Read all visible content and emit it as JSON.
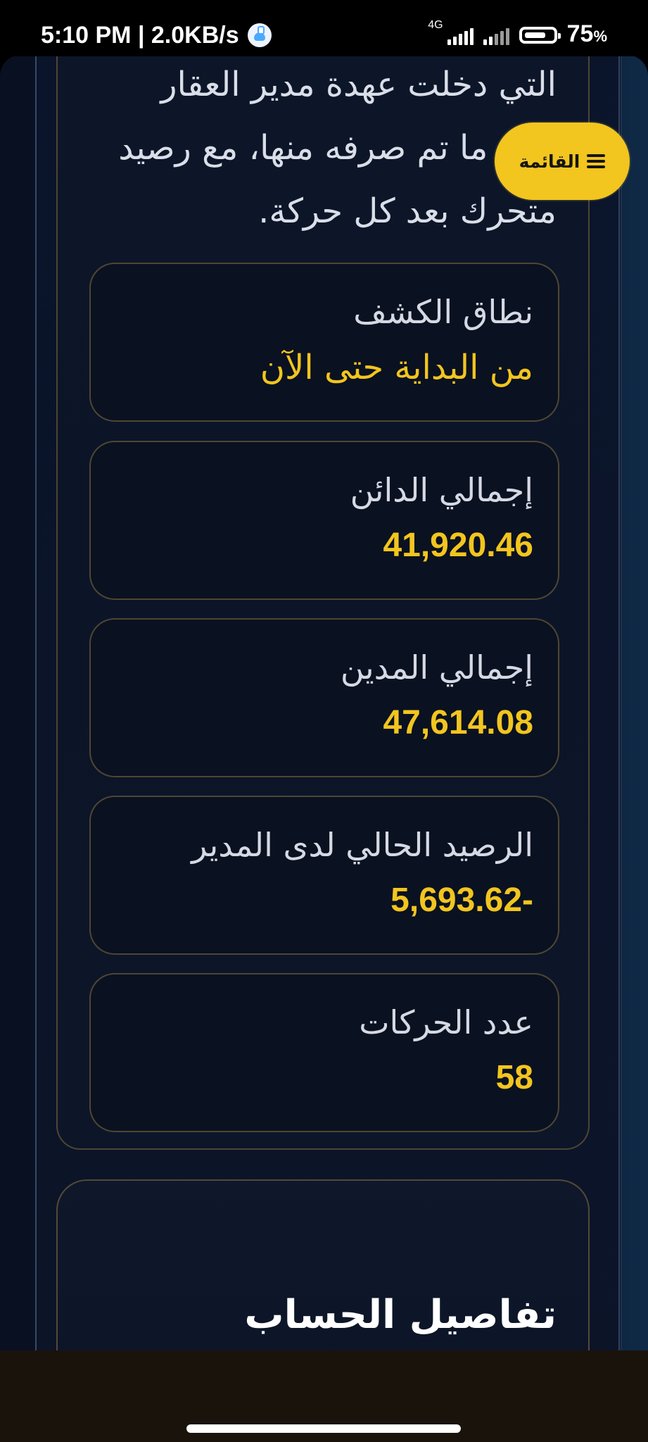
{
  "status_bar": {
    "time_speed": "5:10 PM | 2.0KB/s",
    "network": "4G",
    "battery_percent": "75",
    "battery_suffix": "%",
    "battery_level": 0.75
  },
  "header": {
    "menu_label": "القائمة",
    "menu_icon": "hamburger-icon"
  },
  "intro": {
    "text": "التي دخلت عهدة مدير العقار وكل ما تم صرفه منها، مع رصيد متحرك بعد كل حركة."
  },
  "stats": [
    {
      "label": "نطاق الكشف",
      "value": "من البداية حتى الآن",
      "type": "text"
    },
    {
      "label": "إجمالي الدائن",
      "value": "41,920.46",
      "type": "number"
    },
    {
      "label": "إجمالي المدين",
      "value": "47,614.08",
      "type": "number"
    },
    {
      "label": "الرصيد الحالي لدى المدير",
      "value": "5,693.62-",
      "type": "number"
    },
    {
      "label": "عدد الحركات",
      "value": "58",
      "type": "number"
    }
  ],
  "section": {
    "title": "تفاصيل الحساب"
  },
  "colors": {
    "accent": "#f2c51f",
    "background": "#0b1020",
    "card_border": "#6f5f35",
    "text_primary": "#d9dee8"
  }
}
